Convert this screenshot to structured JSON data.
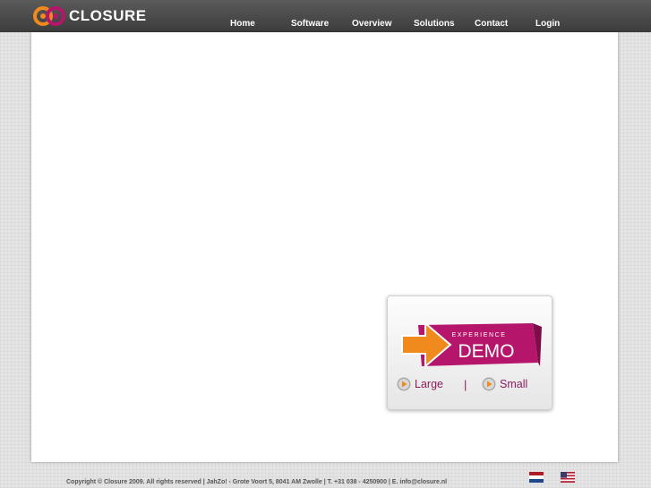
{
  "brand": {
    "logo_text": "CLOSURE"
  },
  "nav": [
    {
      "label": "Home"
    },
    {
      "label": "Software"
    },
    {
      "label": "Overview"
    },
    {
      "label": "Solutions"
    },
    {
      "label": "Contact"
    },
    {
      "label": "Login"
    }
  ],
  "demo": {
    "kicker": "EXPERIENCE",
    "title": "DEMO",
    "large_label": "Large",
    "separator": "|",
    "small_label": "Small"
  },
  "footer": {
    "copyright": "Copyright © Closure 2009. All rights reserved | JahZo! - Grote Voort 5, 8041 AM Zwolle | T. +31 038 - 4250900 | E. info@closure.nl"
  },
  "flags": [
    {
      "name": "dutch-flag-icon"
    },
    {
      "name": "us-flag-icon"
    }
  ],
  "colors": {
    "accent": "#b5166b",
    "arrow": "#f08a1c",
    "topbar": "#4a4a4a"
  }
}
